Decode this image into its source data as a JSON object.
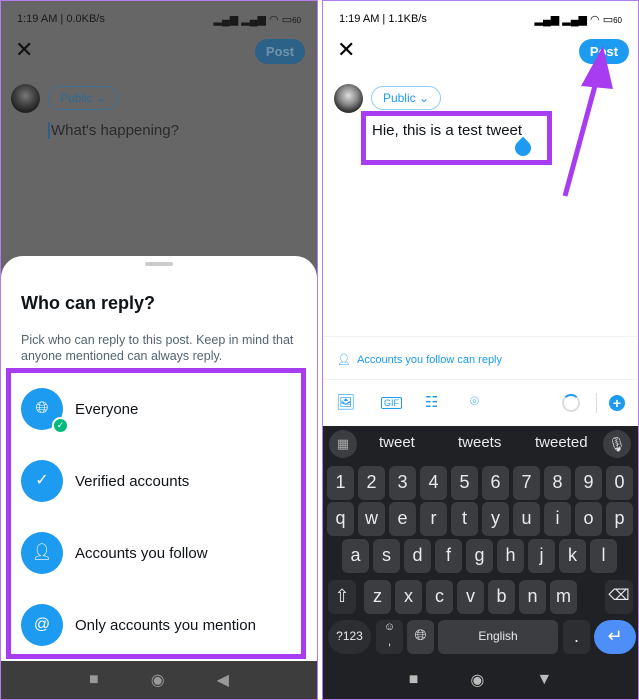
{
  "left": {
    "status": {
      "time": "1:19 AM | 0.0KB/s",
      "battery": "60"
    },
    "post_label": "Post",
    "audience": "Public",
    "placeholder": "What's happening?",
    "sheet": {
      "title": "Who can reply?",
      "description": "Pick who can reply to this post. Keep in mind that anyone mentioned can always reply.",
      "options": [
        {
          "label": "Everyone",
          "icon": "globe-icon",
          "selected": true
        },
        {
          "label": "Verified accounts",
          "icon": "verified-badge-icon",
          "selected": false
        },
        {
          "label": "Accounts you follow",
          "icon": "person-check-icon",
          "selected": false
        },
        {
          "label": "Only accounts you mention",
          "icon": "at-sign-icon",
          "selected": false
        }
      ]
    }
  },
  "right": {
    "status": {
      "time": "1:19 AM | 1.1KB/s",
      "battery": "60"
    },
    "post_label": "Post",
    "audience": "Public",
    "tweet_text": "Hie, this is a test tweet",
    "reply_setting": "Accounts you follow can reply",
    "toolbar": [
      "image-icon",
      "gif-icon",
      "poll-icon",
      "location-icon",
      "progress-ring-icon",
      "add-icon"
    ],
    "keyboard": {
      "suggestions": [
        "tweet",
        "tweets",
        "tweeted"
      ],
      "rows": [
        [
          "1",
          "2",
          "3",
          "4",
          "5",
          "6",
          "7",
          "8",
          "9",
          "0"
        ],
        [
          "q",
          "w",
          "e",
          "r",
          "t",
          "y",
          "u",
          "i",
          "o",
          "p"
        ],
        [
          "a",
          "s",
          "d",
          "f",
          "g",
          "h",
          "j",
          "k",
          "l"
        ],
        [
          "z",
          "x",
          "c",
          "v",
          "b",
          "n",
          "m"
        ]
      ],
      "symbols_label": "?123",
      "space_label": "English",
      "period": "."
    }
  },
  "colors": {
    "accent": "#1d9bf0",
    "highlight": "#a83cf0",
    "keyboard_bg": "#202124",
    "enter": "#4e8ef7"
  }
}
